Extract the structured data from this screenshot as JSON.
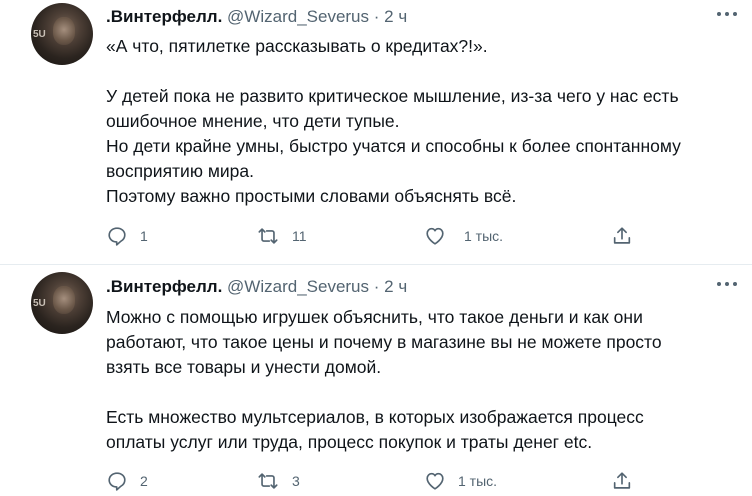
{
  "tweets": [
    {
      "author": ".Винтерфелл.",
      "handle": "@Wizard_Severus",
      "separator": "·",
      "time": "2 ч",
      "lines": [
        "«А что, пятилетке рассказывать о кредитах?!».",
        "",
        "У детей пока не развито критическое мышление, из-за чего у нас есть",
        "ошибочное мнение, что дети тупые.",
        "Но дети крайне умны, быстро учатся и способны к более спонтанному",
        "восприятию мира.",
        "Поэтому важно простыми словами объяснять всё."
      ],
      "replies": "1",
      "retweets": "11",
      "likes": "1 тыс."
    },
    {
      "author": ".Винтерфелл.",
      "handle": "@Wizard_Severus",
      "separator": "·",
      "time": "2 ч",
      "lines": [
        "Можно с помощью игрушек объяснить, что такое деньги и как они",
        "работают, что такое цены и почему в магазине вы не можете просто",
        "взять все товары и унести домой.",
        "",
        "Есть множество мультсериалов, в которых изображается процесс",
        "оплаты услуг или труда, процесс покупок и траты денег etc."
      ],
      "replies": "2",
      "retweets": "3",
      "likes": "1 тыс."
    }
  ],
  "icons": {
    "reply": "reply-icon",
    "retweet": "retweet-icon",
    "like": "heart-icon",
    "share": "share-icon",
    "more": "more-icon"
  },
  "colors": {
    "text": "#0f1419",
    "secondary": "#536471",
    "divider": "#e6ecf0"
  }
}
